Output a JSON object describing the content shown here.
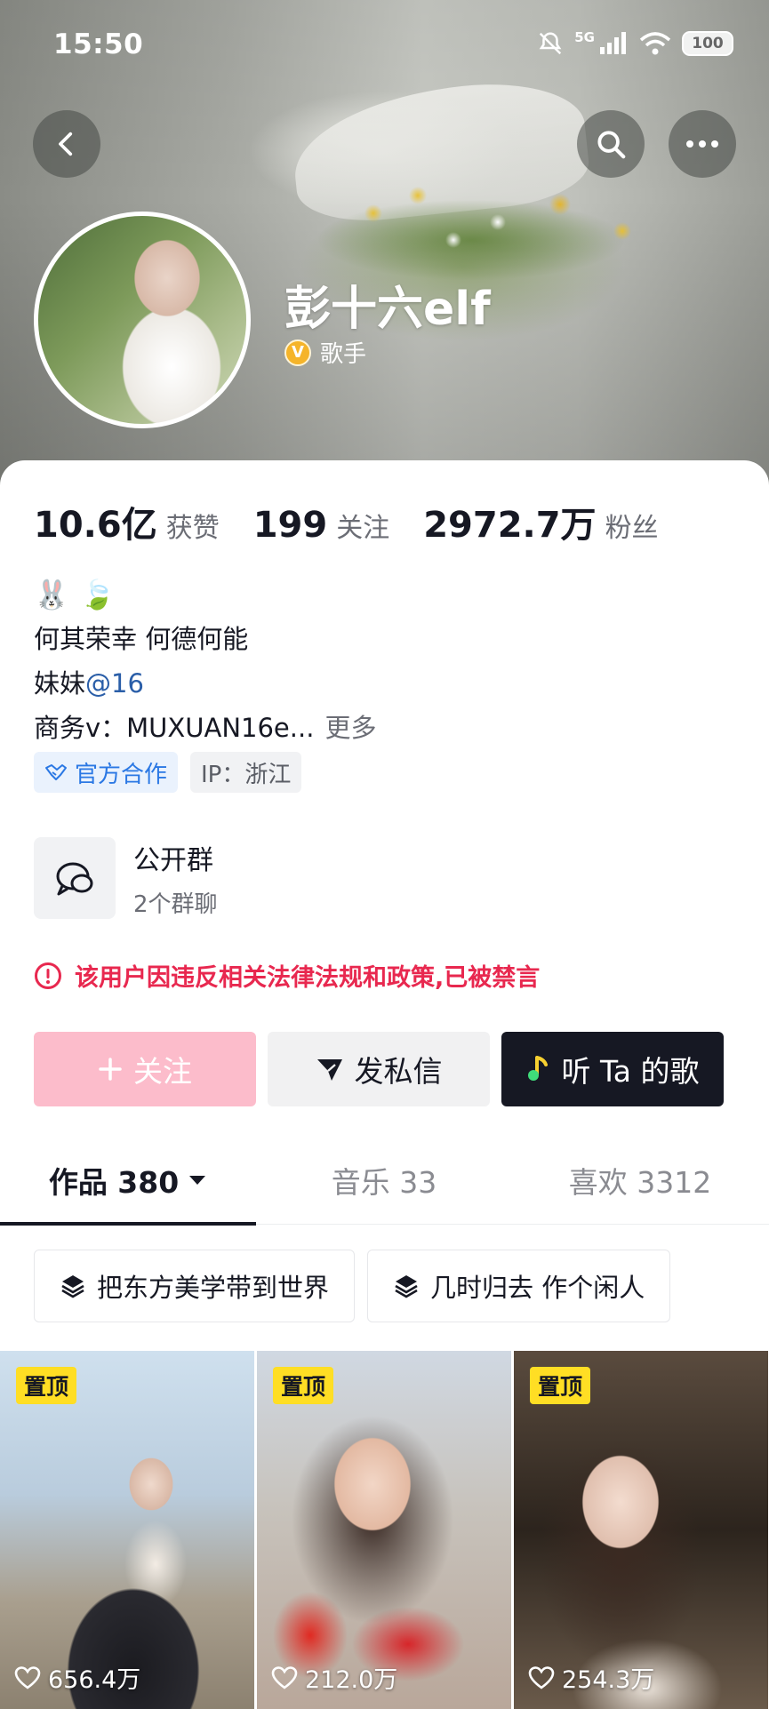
{
  "status_bar": {
    "time": "15:50",
    "network": "5G",
    "battery": "100"
  },
  "profile": {
    "username": "彭十六elf",
    "verified_title": "歌手",
    "verified_badge": "V",
    "stats": [
      {
        "value": "10.6亿",
        "label": "获赞"
      },
      {
        "value": "199",
        "label": "关注"
      },
      {
        "value": "2972.7万",
        "label": "粉丝"
      }
    ],
    "bio_emojis": [
      "🐰",
      "🍃"
    ],
    "bio_line1": "何其荣幸 何德何能",
    "bio_line2_prefix": "妹妹",
    "bio_line2_mention": "@16",
    "bio_line3": "商务v：MUXUAN16e...",
    "more_label": "更多",
    "tag_official": "官方合作",
    "tag_ip": "IP：浙江"
  },
  "group": {
    "title": "公开群",
    "subtitle": "2个群聊"
  },
  "warning": "该用户因违反相关法律法规和政策,已被禁言",
  "actions": {
    "follow": "关注",
    "message": "发私信",
    "listen": "听 Ta 的歌"
  },
  "tabs": [
    {
      "label": "作品 380"
    },
    {
      "label": "音乐 33"
    },
    {
      "label": "喜欢 3312"
    }
  ],
  "collections": [
    "把东方美学带到世界",
    "几时归去 作个闲人"
  ],
  "videos": [
    {
      "pinned": "置顶",
      "likes": "656.4万"
    },
    {
      "pinned": "置顶",
      "likes": "212.0万"
    },
    {
      "pinned": "置顶",
      "likes": "254.3万"
    }
  ],
  "colors": {
    "accent": "#fe2c55",
    "warning": "#e8284f",
    "follow_disabled": "#fcbccb",
    "dark": "#161823",
    "pin": "#ffde24",
    "link": "#2a5ea8"
  }
}
